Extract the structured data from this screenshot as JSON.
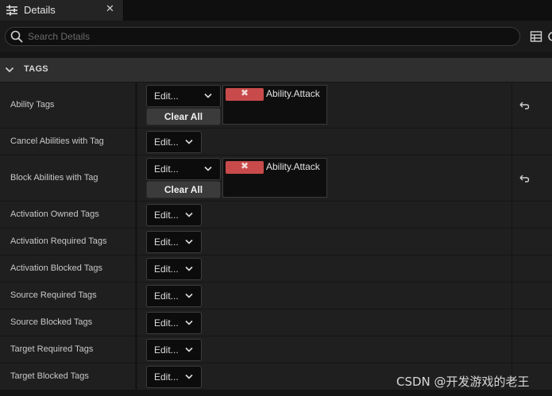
{
  "tab": {
    "title": "Details",
    "close_glyph": "✕",
    "icon": "sliders-icon"
  },
  "search": {
    "placeholder": "Search Details",
    "value": ""
  },
  "toolbar": {
    "icons": [
      "grid-icon",
      "more-icon"
    ]
  },
  "category": {
    "title": "TAGS",
    "expanded": true
  },
  "edit_label": "Edit...",
  "clear_label": "Clear All",
  "tag_remove_glyph": "✖",
  "rows": [
    {
      "label": "Ability Tags",
      "tags": [
        "Ability.Attack"
      ],
      "has_reset": true
    },
    {
      "label": "Cancel Abilities with Tag",
      "tags": [],
      "has_reset": false
    },
    {
      "label": "Block Abilities with Tag",
      "tags": [
        "Ability.Attack"
      ],
      "has_reset": true
    },
    {
      "label": "Activation Owned Tags",
      "tags": [],
      "has_reset": false
    },
    {
      "label": "Activation Required Tags",
      "tags": [],
      "has_reset": false
    },
    {
      "label": "Activation Blocked Tags",
      "tags": [],
      "has_reset": false
    },
    {
      "label": "Source Required Tags",
      "tags": [],
      "has_reset": false
    },
    {
      "label": "Source Blocked Tags",
      "tags": [],
      "has_reset": false
    },
    {
      "label": "Target Required Tags",
      "tags": [],
      "has_reset": false
    },
    {
      "label": "Target Blocked Tags",
      "tags": [],
      "has_reset": false
    }
  ],
  "watermark": "CSDN @开发游戏的老王",
  "colors": {
    "tag_remove": "#c84a4a",
    "panel": "#1f1f1f",
    "category": "#2f2f2f"
  }
}
